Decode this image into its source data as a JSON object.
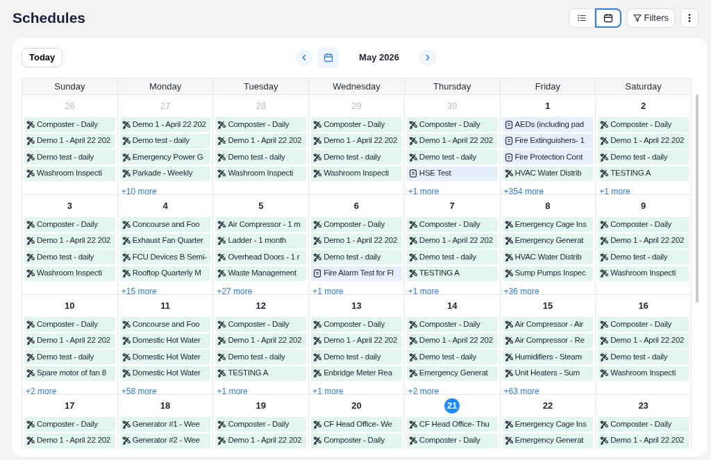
{
  "page": {
    "title": "Schedules"
  },
  "toolbar": {
    "views": [
      {
        "kind": "list",
        "selected": false
      },
      {
        "kind": "calendar",
        "selected": true
      }
    ],
    "filters_button": "Filters"
  },
  "calendar": {
    "today_button": "Today",
    "month_label": "May 2026",
    "weekdays": [
      "Sunday",
      "Monday",
      "Tuesday",
      "Wednesday",
      "Thursday",
      "Friday",
      "Saturday"
    ],
    "weeks": [
      [
        {
          "day": "26",
          "outside_month": true,
          "today": false,
          "events": [
            {
              "kind": "task",
              "title": "Composter - Daily"
            },
            {
              "kind": "task",
              "title": "Demo 1 - April 22 202"
            },
            {
              "kind": "task",
              "title": "Demo test - daily"
            },
            {
              "kind": "task",
              "title": "Washroom Inspecti"
            }
          ]
        },
        {
          "day": "27",
          "outside_month": true,
          "today": false,
          "events": [
            {
              "kind": "task",
              "title": "Demo 1 - April 22 202"
            },
            {
              "kind": "task",
              "title": "Demo test - daily"
            },
            {
              "kind": "task",
              "title": "Emergency Power G"
            },
            {
              "kind": "task",
              "title": "Parkade - Weekly"
            }
          ],
          "more": "+10 more"
        },
        {
          "day": "28",
          "outside_month": true,
          "today": false,
          "events": [
            {
              "kind": "task",
              "title": "Composter - Daily"
            },
            {
              "kind": "task",
              "title": "Demo 1 - April 22 202"
            },
            {
              "kind": "task",
              "title": "Demo test - daily"
            },
            {
              "kind": "task",
              "title": "Washroom Inspecti"
            }
          ]
        },
        {
          "day": "29",
          "outside_month": true,
          "today": false,
          "events": [
            {
              "kind": "task",
              "title": "Composter - Daily"
            },
            {
              "kind": "task",
              "title": "Demo 1 - April 22 202"
            },
            {
              "kind": "task",
              "title": "Demo test - daily"
            },
            {
              "kind": "task",
              "title": "Washroom Inspecti"
            }
          ]
        },
        {
          "day": "30",
          "outside_month": true,
          "today": false,
          "events": [
            {
              "kind": "task",
              "title": "Composter - Daily"
            },
            {
              "kind": "task",
              "title": "Demo 1 - April 22 202"
            },
            {
              "kind": "task",
              "title": "Demo test - daily"
            },
            {
              "kind": "form",
              "title": "HSE Test"
            }
          ],
          "more": "+1 more"
        },
        {
          "day": "1",
          "outside_month": false,
          "today": false,
          "events": [
            {
              "kind": "form",
              "title": "AEDs (including pad"
            },
            {
              "kind": "form",
              "title": "Fire Extinguishers- 1"
            },
            {
              "kind": "form",
              "title": "Fire Protection Cont"
            },
            {
              "kind": "task",
              "title": "HVAC Water Distrib"
            }
          ],
          "more": "+354 more"
        },
        {
          "day": "2",
          "outside_month": false,
          "today": false,
          "events": [
            {
              "kind": "task",
              "title": "Composter - Daily"
            },
            {
              "kind": "task",
              "title": "Demo 1 - April 22 202"
            },
            {
              "kind": "task",
              "title": "Demo test - daily"
            },
            {
              "kind": "task",
              "title": "TESTING A"
            }
          ],
          "more": "+1 more"
        }
      ],
      [
        {
          "day": "3",
          "outside_month": false,
          "today": false,
          "events": [
            {
              "kind": "task",
              "title": "Composter - Daily"
            },
            {
              "kind": "task",
              "title": "Demo 1 - April 22 202"
            },
            {
              "kind": "task",
              "title": "Demo test - daily"
            },
            {
              "kind": "task",
              "title": "Washroom Inspecti"
            }
          ]
        },
        {
          "day": "4",
          "outside_month": false,
          "today": false,
          "events": [
            {
              "kind": "task",
              "title": "Concourse and Foo"
            },
            {
              "kind": "task",
              "title": "Exhaust Fan Quarter"
            },
            {
              "kind": "task",
              "title": "FCU Devices B Semi-"
            },
            {
              "kind": "task",
              "title": "Rooftop Quarterly M"
            }
          ],
          "more": "+15 more"
        },
        {
          "day": "5",
          "outside_month": false,
          "today": false,
          "events": [
            {
              "kind": "task",
              "title": "Air Compressor - 1 m"
            },
            {
              "kind": "task",
              "title": "Ladder - 1 month"
            },
            {
              "kind": "task",
              "title": "Overhead Doors - 1 r"
            },
            {
              "kind": "task",
              "title": "Waste Management"
            }
          ],
          "more": "+27 more"
        },
        {
          "day": "6",
          "outside_month": false,
          "today": false,
          "events": [
            {
              "kind": "task",
              "title": "Composter - Daily"
            },
            {
              "kind": "task",
              "title": "Demo 1 - April 22 202"
            },
            {
              "kind": "task",
              "title": "Demo test - daily"
            },
            {
              "kind": "form",
              "title": "Fire Alarm Test for Fl"
            }
          ],
          "more": "+1 more"
        },
        {
          "day": "7",
          "outside_month": false,
          "today": false,
          "events": [
            {
              "kind": "task",
              "title": "Composter - Daily"
            },
            {
              "kind": "task",
              "title": "Demo 1 - April 22 202"
            },
            {
              "kind": "task",
              "title": "Demo test - daily"
            },
            {
              "kind": "task",
              "title": "TESTING A"
            }
          ],
          "more": "+1 more"
        },
        {
          "day": "8",
          "outside_month": false,
          "today": false,
          "events": [
            {
              "kind": "task",
              "title": "Emergency Cage Ins"
            },
            {
              "kind": "task",
              "title": "Emergency Generat"
            },
            {
              "kind": "task",
              "title": "HVAC Water Distrib"
            },
            {
              "kind": "task",
              "title": "Sump Pumps Inspec"
            }
          ],
          "more": "+36 more"
        },
        {
          "day": "9",
          "outside_month": false,
          "today": false,
          "events": [
            {
              "kind": "task",
              "title": "Composter - Daily"
            },
            {
              "kind": "task",
              "title": "Demo 1 - April 22 202"
            },
            {
              "kind": "task",
              "title": "Demo test - daily"
            },
            {
              "kind": "task",
              "title": "Washroom Inspecti"
            }
          ]
        }
      ],
      [
        {
          "day": "10",
          "outside_month": false,
          "today": false,
          "events": [
            {
              "kind": "task",
              "title": "Composter - Daily"
            },
            {
              "kind": "task",
              "title": "Demo 1 - April 22 202"
            },
            {
              "kind": "task",
              "title": "Demo test - daily"
            },
            {
              "kind": "task",
              "title": "Spare motor of fan 8"
            }
          ],
          "more": "+2 more"
        },
        {
          "day": "11",
          "outside_month": false,
          "today": false,
          "events": [
            {
              "kind": "task",
              "title": "Concourse and Foo"
            },
            {
              "kind": "task",
              "title": "Domestic Hot Water"
            },
            {
              "kind": "task",
              "title": "Domestic Hot Water"
            },
            {
              "kind": "task",
              "title": "Domestic Hot Water"
            }
          ],
          "more": "+58 more"
        },
        {
          "day": "12",
          "outside_month": false,
          "today": false,
          "events": [
            {
              "kind": "task",
              "title": "Composter - Daily"
            },
            {
              "kind": "task",
              "title": "Demo 1 - April 22 202"
            },
            {
              "kind": "task",
              "title": "Demo test - daily"
            },
            {
              "kind": "task",
              "title": "TESTING A"
            }
          ],
          "more": "+1 more"
        },
        {
          "day": "13",
          "outside_month": false,
          "today": false,
          "events": [
            {
              "kind": "task",
              "title": "Composter - Daily"
            },
            {
              "kind": "task",
              "title": "Demo 1 - April 22 202"
            },
            {
              "kind": "task",
              "title": "Demo test - daily"
            },
            {
              "kind": "task",
              "title": "Enbridge Meter Rea"
            }
          ],
          "more": "+1 more"
        },
        {
          "day": "14",
          "outside_month": false,
          "today": false,
          "events": [
            {
              "kind": "task",
              "title": "Composter - Daily"
            },
            {
              "kind": "task",
              "title": "Demo 1 - April 22 202"
            },
            {
              "kind": "task",
              "title": "Demo test - daily"
            },
            {
              "kind": "task",
              "title": "Emergency Generat"
            }
          ],
          "more": "+2 more"
        },
        {
          "day": "15",
          "outside_month": false,
          "today": false,
          "events": [
            {
              "kind": "task",
              "title": "Air Compressor - Air"
            },
            {
              "kind": "task",
              "title": "Air Compressor - Re"
            },
            {
              "kind": "task",
              "title": "Humidifiers - Steam"
            },
            {
              "kind": "task",
              "title": "Unit Heaters - Sum"
            }
          ],
          "more": "+63 more"
        },
        {
          "day": "16",
          "outside_month": false,
          "today": false,
          "events": [
            {
              "kind": "task",
              "title": "Composter - Daily"
            },
            {
              "kind": "task",
              "title": "Demo 1 - April 22 202"
            },
            {
              "kind": "task",
              "title": "Demo test - daily"
            },
            {
              "kind": "task",
              "title": "Washroom Inspecti"
            }
          ]
        }
      ],
      [
        {
          "day": "17",
          "outside_month": false,
          "today": false,
          "events": [
            {
              "kind": "task",
              "title": "Composter - Daily"
            },
            {
              "kind": "task",
              "title": "Demo 1 - April 22 202"
            }
          ]
        },
        {
          "day": "18",
          "outside_month": false,
          "today": false,
          "events": [
            {
              "kind": "task",
              "title": "Generator #1 - Wee"
            },
            {
              "kind": "task",
              "title": "Generator #2 - Wee"
            }
          ]
        },
        {
          "day": "19",
          "outside_month": false,
          "today": false,
          "events": [
            {
              "kind": "task",
              "title": "Composter - Daily"
            },
            {
              "kind": "task",
              "title": "Demo 1 - April 22 202"
            }
          ]
        },
        {
          "day": "20",
          "outside_month": false,
          "today": false,
          "events": [
            {
              "kind": "task",
              "title": "CF Head Office- We"
            },
            {
              "kind": "task",
              "title": "Composter - Daily"
            }
          ]
        },
        {
          "day": "21",
          "outside_month": false,
          "today": true,
          "events": [
            {
              "kind": "task",
              "title": "CF Head Office- Thu"
            },
            {
              "kind": "task",
              "title": "Composter - Daily"
            }
          ]
        },
        {
          "day": "22",
          "outside_month": false,
          "today": false,
          "events": [
            {
              "kind": "task",
              "title": "Emergency Cage Ins"
            },
            {
              "kind": "task",
              "title": "Emergency Generat"
            }
          ]
        },
        {
          "day": "23",
          "outside_month": false,
          "today": false,
          "events": [
            {
              "kind": "task",
              "title": "Composter - Daily"
            },
            {
              "kind": "task",
              "title": "Demo 1 - April 22 202"
            }
          ]
        }
      ]
    ]
  }
}
